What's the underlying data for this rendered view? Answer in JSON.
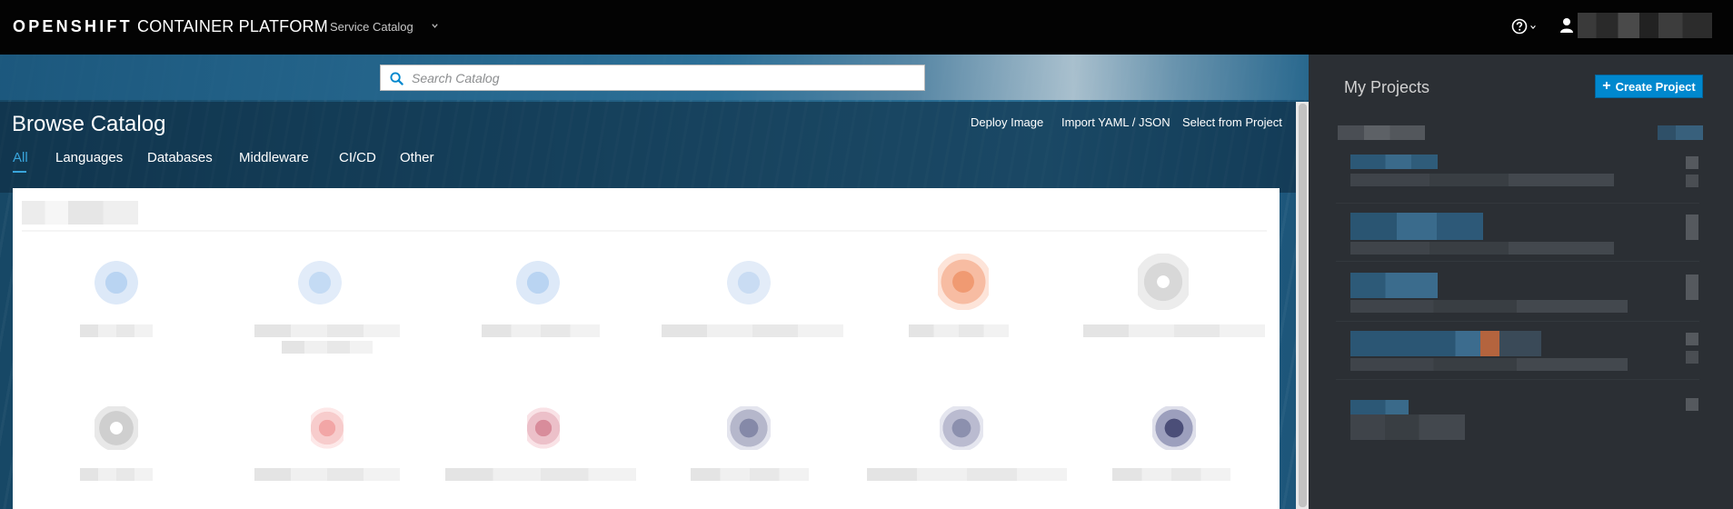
{
  "navbar": {
    "brand_bold": "OPENSHIFT",
    "brand_rest": " CONTAINER PLATFORM",
    "context_dropdown": "Service Catalog"
  },
  "search": {
    "placeholder": "Search Catalog"
  },
  "header": {
    "title": "Browse Catalog",
    "actions": [
      "Deploy Image",
      "Import YAML / JSON",
      "Select from Project"
    ]
  },
  "tabs": [
    "All",
    "Languages",
    "Databases",
    "Middleware",
    "CI/CD",
    "Other"
  ],
  "active_tab": "All",
  "projects_panel": {
    "title": "My Projects",
    "create_button": "Create Project"
  },
  "colors": {
    "navbar": "#030303",
    "accent": "#39a5dc",
    "primary_button": "#0088ce",
    "panel": "#2b2f34"
  }
}
